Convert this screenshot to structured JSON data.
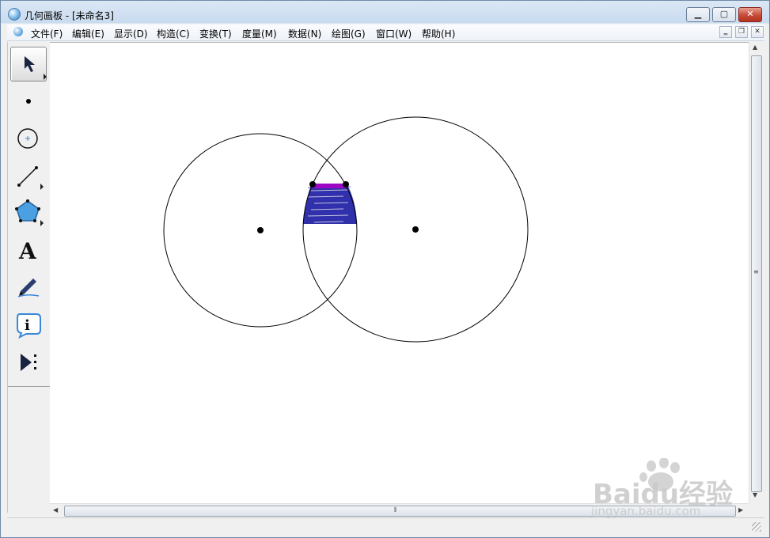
{
  "window": {
    "title": "几何画板 - [未命名3]",
    "controls": {
      "minimize": "▁",
      "maximize": "▢",
      "close": "✕"
    }
  },
  "menu": {
    "items": [
      "文件(F)",
      "编辑(E)",
      "显示(D)",
      "构造(C)",
      "变换(T)",
      "度量(M)",
      "数据(N)",
      "绘图(G)",
      "窗口(W)",
      "帮助(H)"
    ],
    "mdi_controls": [
      "‗",
      "❐",
      "✕"
    ]
  },
  "toolbox": {
    "tools": [
      {
        "name": "arrow-tool",
        "icon": "arrow-select-icon",
        "selected": true
      },
      {
        "name": "point-tool",
        "icon": "point-icon",
        "selected": false
      },
      {
        "name": "compass-tool",
        "icon": "circle-icon",
        "selected": false
      },
      {
        "name": "straightedge-tool",
        "icon": "segment-icon",
        "selected": false
      },
      {
        "name": "polygon-tool",
        "icon": "pentagon-icon",
        "selected": false
      },
      {
        "name": "text-tool",
        "icon": "text-a-icon",
        "label": "A",
        "selected": false
      },
      {
        "name": "marker-tool",
        "icon": "marker-pen-icon",
        "selected": false
      },
      {
        "name": "information-tool",
        "icon": "info-icon",
        "label": "i",
        "selected": false
      },
      {
        "name": "custom-tool",
        "icon": "play-custom-icon",
        "selected": false
      }
    ]
  },
  "sketch": {
    "circles": [
      {
        "name": "left-circle"
      },
      {
        "name": "right-circle"
      }
    ],
    "colors": {
      "stroke": "#000000",
      "marker_fill": "#1a1aa0",
      "marker_highlight": "#b000c8"
    }
  },
  "scrollbars": {
    "vertical_grip": "≡",
    "horizontal_grip": "⦀"
  },
  "watermark": {
    "brand": "Baidu经验",
    "url": "jingyan.baidu.com"
  }
}
